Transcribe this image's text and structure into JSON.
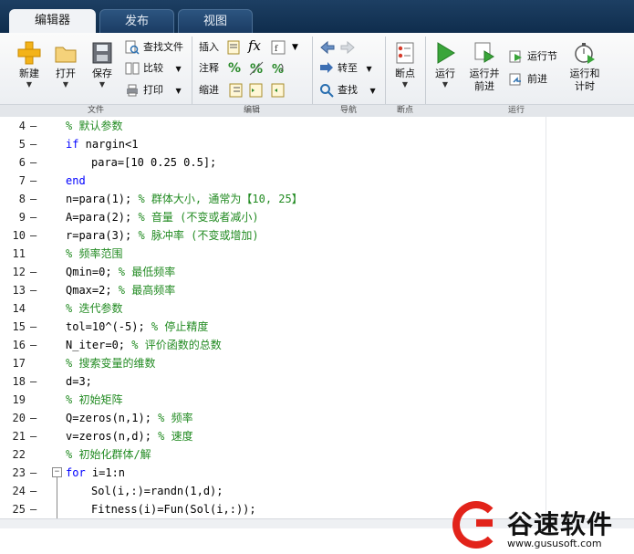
{
  "tabs": [
    {
      "label": "编辑器",
      "active": true
    },
    {
      "label": "发布",
      "active": false
    },
    {
      "label": "视图",
      "active": false
    }
  ],
  "ribbon": {
    "file": {
      "section_label": "文件",
      "new_label": "新建",
      "open_label": "打开",
      "save_label": "保存",
      "find_files_label": "查找文件",
      "compare_label": "比较",
      "print_label": "打印"
    },
    "edit": {
      "section_label": "编辑",
      "insert_label": "插入",
      "comment_label": "注释",
      "indent_label": "缩进",
      "fx_label": "fx",
      "percent_label": "%"
    },
    "navigate": {
      "section_label": "导航",
      "goto_label": "转至",
      "find_label": "查找"
    },
    "breakpoints": {
      "section_label": "断点",
      "breakpoints_label": "断点"
    },
    "run": {
      "section_label": "运行",
      "run_label": "运行",
      "run_advance_label_1": "运行并",
      "run_advance_label_2": "前进",
      "run_section_label": "运行节",
      "advance_label": "前进",
      "run_time_label_1": "运行和",
      "run_time_label_2": "计时"
    }
  },
  "code_lines": [
    {
      "n": "4",
      "dash": "–",
      "text": "% 默认参数",
      "type": "comment",
      "indent": 0
    },
    {
      "n": "5",
      "dash": "–",
      "text": "if nargin<1",
      "type": "kw_if",
      "indent": 0
    },
    {
      "n": "6",
      "dash": "–",
      "text": "para=[10 0.25 0.5];",
      "type": "code",
      "indent": 1
    },
    {
      "n": "7",
      "dash": "–",
      "text": "end",
      "type": "kw",
      "indent": 0
    },
    {
      "n": "8",
      "dash": "–",
      "text": "n=para(1); ",
      "comment": "% 群体大小, 通常为【10, 25】",
      "type": "code_comment",
      "indent": 0
    },
    {
      "n": "9",
      "dash": "–",
      "text": "A=para(2); ",
      "comment": "% 音量 (不变或者减小)",
      "type": "code_comment",
      "indent": 0
    },
    {
      "n": "10",
      "dash": "–",
      "text": "r=para(3); ",
      "comment": "% 脉冲率 (不变或增加)",
      "type": "code_comment",
      "indent": 0
    },
    {
      "n": "11",
      "dash": "",
      "text": "% 频率范围",
      "type": "comment",
      "indent": 0
    },
    {
      "n": "12",
      "dash": "–",
      "text": "Qmin=0; ",
      "comment": "% 最低频率",
      "type": "code_comment",
      "indent": 0
    },
    {
      "n": "13",
      "dash": "–",
      "text": "Qmax=2; ",
      "comment": "% 最高频率",
      "type": "code_comment",
      "indent": 0
    },
    {
      "n": "14",
      "dash": "",
      "text": "% 迭代参数",
      "type": "comment",
      "indent": 0
    },
    {
      "n": "15",
      "dash": "–",
      "text": "tol=10^(-5); ",
      "comment": "% 停止精度",
      "type": "code_comment",
      "indent": 0
    },
    {
      "n": "16",
      "dash": "–",
      "text": "N_iter=0; ",
      "comment": "% 评价函数的总数",
      "type": "code_comment",
      "indent": 0
    },
    {
      "n": "17",
      "dash": "",
      "text": "% 搜索变量的维数",
      "type": "comment",
      "indent": 0
    },
    {
      "n": "18",
      "dash": "–",
      "text": "d=3;",
      "type": "code",
      "indent": 0
    },
    {
      "n": "19",
      "dash": "",
      "text": "% 初始矩阵",
      "type": "comment",
      "indent": 0
    },
    {
      "n": "20",
      "dash": "–",
      "text": "Q=zeros(n,1); ",
      "comment": "% 频率",
      "type": "code_comment",
      "indent": 0
    },
    {
      "n": "21",
      "dash": "–",
      "text": "v=zeros(n,d); ",
      "comment": "% 速度",
      "type": "code_comment",
      "indent": 0
    },
    {
      "n": "22",
      "dash": "",
      "text": "% 初始化群体/解",
      "type": "comment",
      "indent": 0
    },
    {
      "n": "23",
      "dash": "–",
      "text": "for i=1:n",
      "type": "kw_for",
      "indent": 0
    },
    {
      "n": "24",
      "dash": "–",
      "text": "Sol(i,:)=randn(1,d);",
      "type": "code",
      "indent": 1
    },
    {
      "n": "25",
      "dash": "–",
      "text": "Fitness(i)=Fun(Sol(i,:));",
      "type": "code",
      "indent": 1
    }
  ],
  "watermark": {
    "brand": "谷速软件",
    "url": "www.gususoft.com"
  },
  "colors": {
    "comment": "#228b22",
    "keyword": "#0000ff",
    "tabbar": "#163a60",
    "watermark_red": "#e2231a"
  }
}
